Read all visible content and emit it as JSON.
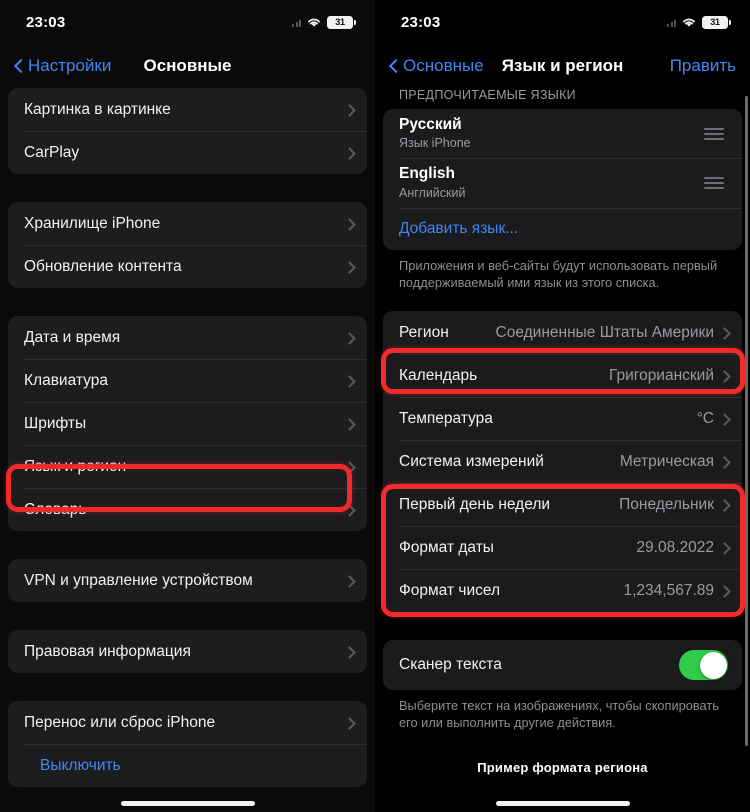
{
  "left_panel": {
    "status_bar": {
      "time": "23:03",
      "battery_level": "31",
      "wifi_icon": "wifi-icon",
      "signal_icon": "signal-dots-icon"
    },
    "nav": {
      "back_label": "Настройки",
      "title": "Основные"
    },
    "groups": [
      {
        "rows": [
          {
            "label": "Картинка в картинке"
          },
          {
            "label": "CarPlay"
          }
        ]
      },
      {
        "rows": [
          {
            "label": "Хранилище iPhone"
          },
          {
            "label": "Обновление контента"
          }
        ]
      },
      {
        "rows": [
          {
            "label": "Дата и время"
          },
          {
            "label": "Клавиатура"
          },
          {
            "label": "Шрифты"
          },
          {
            "label": "Язык и регион",
            "highlighted": true
          },
          {
            "label": "Словарь"
          }
        ]
      },
      {
        "rows": [
          {
            "label": "VPN и управление устройством"
          }
        ]
      },
      {
        "rows": [
          {
            "label": "Правовая информация"
          }
        ]
      },
      {
        "rows": [
          {
            "label": "Перенос или сброс iPhone"
          }
        ]
      }
    ],
    "cut_off_item": "Выключить"
  },
  "right_panel": {
    "status_bar": {
      "time": "23:03",
      "battery_level": "31",
      "wifi_icon": "wifi-icon",
      "signal_icon": "signal-dots-icon"
    },
    "nav": {
      "back_label": "Основные",
      "title": "Язык и регион",
      "edit_label": "Править"
    },
    "languages_section": {
      "header": "ПРЕДПОЧИТАЕМЫЕ ЯЗЫКИ",
      "items": [
        {
          "name": "Русский",
          "sub": "Язык iPhone",
          "handle_icon": "drag-handle-icon"
        },
        {
          "name": "English",
          "sub": "Английский",
          "handle_icon": "drag-handle-icon"
        }
      ],
      "add_language_label": "Добавить язык...",
      "footnote": "Приложения и веб-сайты будут использовать первый поддерживаемый ими язык из этого списка."
    },
    "region_rows": [
      {
        "label": "Регион",
        "value": "Соединенные Штаты Америки",
        "highlighted": true
      },
      {
        "label": "Календарь",
        "value": "Григорианский"
      },
      {
        "label": "Температура",
        "value": "°C"
      },
      {
        "label": "Система измерений",
        "value": "Метрическая",
        "highlighted": true
      },
      {
        "label": "Первый день недели",
        "value": "Понедельник",
        "highlighted": true
      },
      {
        "label": "Формат даты",
        "value": "29.08.2022",
        "highlighted": true
      },
      {
        "label": "Формат чисел",
        "value": "1,234,567.89"
      }
    ],
    "text_scanner": {
      "label": "Сканер текста",
      "enabled": true,
      "footnote": "Выберите текст на изображениях, чтобы скопировать его или выполнить другие действия."
    },
    "cut_off_header": "Пример формата региона"
  },
  "colors": {
    "accent_blue": "#3f87f5",
    "highlight_red": "#f42a2a",
    "toggle_green": "#2ecc4a",
    "group_bg": "#1d1d1f",
    "page_bg": "#000000"
  }
}
